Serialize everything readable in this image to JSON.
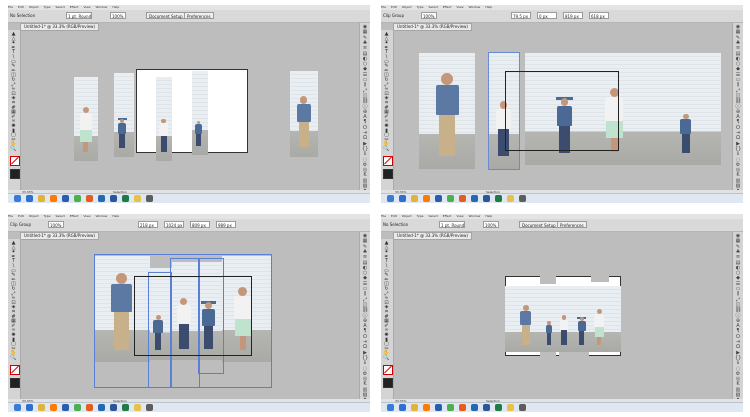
{
  "app": {
    "menu_items": [
      "File",
      "Edit",
      "Object",
      "Type",
      "Select",
      "Effect",
      "View",
      "Window",
      "Help"
    ],
    "document_tab_label": "Untitled-1* @ 33.3% (RGB/Preview)",
    "zoom_status": "33.33%",
    "status_mode": "Selection",
    "panels": [
      {
        "selection_label": "No Selection",
        "stroke_label": "1 pt. Round",
        "opacity_value": "100%",
        "document_setup_label": "Document Setup",
        "preferences_label": "Preferences",
        "fields": []
      },
      {
        "selection_label": "Clip Group",
        "stroke_label": "",
        "opacity_value": "100%",
        "document_setup_label": "",
        "preferences_label": "",
        "fields": [
          "79.5 px",
          "0 px",
          "819 px",
          "618 px"
        ]
      },
      {
        "selection_label": "Clip Group",
        "stroke_label": "",
        "opacity_value": "100%",
        "document_setup_label": "",
        "preferences_label": "",
        "fields": [
          "218 px",
          "1024 px",
          "809 px",
          "989 px"
        ]
      },
      {
        "selection_label": "No Selection",
        "stroke_label": "1 pt. Round",
        "opacity_value": "100%",
        "document_setup_label": "Document Setup",
        "preferences_label": "Preferences",
        "fields": []
      }
    ]
  },
  "colors": {
    "canvas": "#bdbdbd",
    "selection_blue": "#5a7fd6",
    "shirt_blue": "#5b79a3",
    "shirt_white": "#f2f2f2",
    "khaki": "#c8b08a",
    "jeans": "#3c4c6e",
    "skirt_mint": "#bfe3cf",
    "dress_blue": "#4a6a95"
  },
  "icons": {
    "tools": [
      "selection-tool-icon",
      "direct-select-icon",
      "magic-wand-icon",
      "pen-tool-icon",
      "type-tool-icon",
      "line-tool-icon",
      "rectangle-tool-icon",
      "paintbrush-icon",
      "pencil-icon",
      "eraser-icon",
      "rotate-icon",
      "scale-icon",
      "warp-icon",
      "free-transform-icon",
      "shape-builder-icon",
      "perspective-icon",
      "mesh-icon",
      "gradient-icon",
      "eyedropper-icon",
      "blend-icon",
      "symbol-sprayer-icon",
      "graph-icon",
      "artboard-icon",
      "slice-icon",
      "hand-icon",
      "zoom-icon"
    ],
    "dock": [
      "color-panel-icon",
      "swatches-icon",
      "brushes-icon",
      "symbols-icon",
      "stroke-icon",
      "gradient-panel-icon",
      "transparency-icon",
      "appearance-icon",
      "graphic-styles-icon",
      "layers-icon",
      "artboards-icon",
      "align-icon",
      "transform-icon",
      "pathfinder-icon",
      "links-icon",
      "info-icon",
      "navigator-icon",
      "character-icon",
      "paragraph-icon",
      "opentype-icon",
      "tabs-icon",
      "glyphs-icon",
      "actions-icon",
      "variables-icon",
      "document-info-icon",
      "flattener-icon",
      "attributes-icon",
      "color-guide-icon",
      "kuler-icon",
      "swatch-libraries-icon",
      "brush-libraries-icon",
      "symbol-libraries-icon"
    ],
    "taskbar": [
      "start-icon",
      "ie-icon",
      "explorer-icon",
      "illustrator-icon",
      "photoshop-icon",
      "chrome-icon",
      "firefox-icon",
      "outlook-icon",
      "word-icon",
      "excel-icon",
      "folder-icon",
      "media-icon"
    ]
  }
}
